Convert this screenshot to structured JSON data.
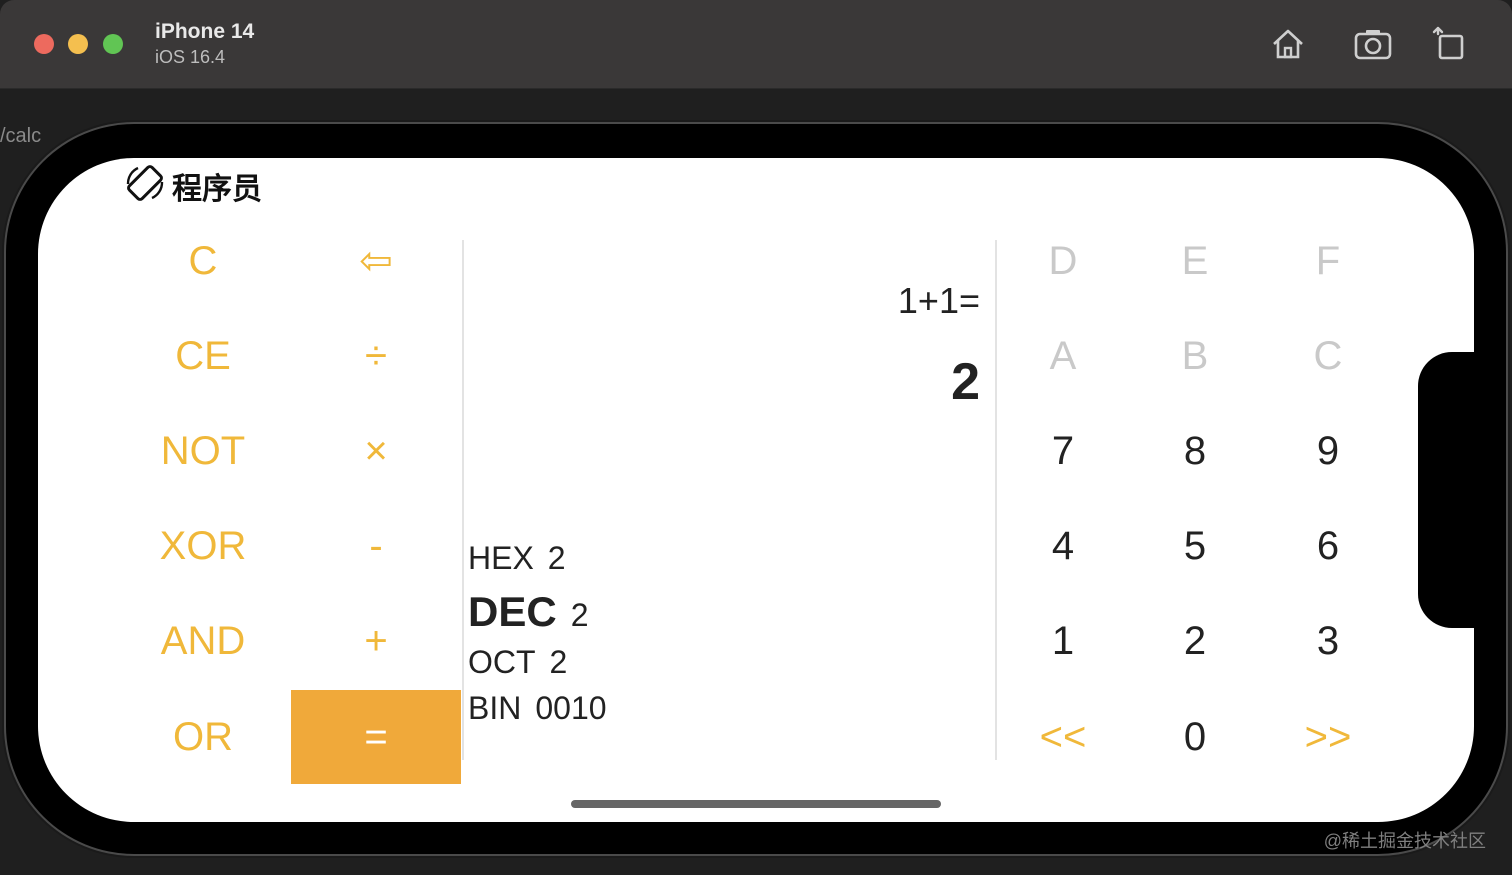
{
  "simulator": {
    "device": "iPhone 14",
    "os": "iOS 16.4",
    "icons": [
      "home-icon",
      "screenshot-icon",
      "rotate-icon"
    ]
  },
  "background": {
    "code_hint": "/calc",
    "watermark": "@稀土掘金技术社区"
  },
  "app": {
    "mode_label": "程序员",
    "mode_icon": "rotate-device-icon",
    "display": {
      "expression": "1+1=",
      "result": "2"
    },
    "bases": [
      {
        "name": "HEX",
        "value": "2",
        "selected": false
      },
      {
        "name": "DEC",
        "value": "2",
        "selected": true
      },
      {
        "name": "OCT",
        "value": "2",
        "selected": false
      },
      {
        "name": "BIN",
        "value": "0010",
        "selected": false
      }
    ],
    "left_keys": [
      {
        "label": "C"
      },
      {
        "label": "⇦"
      },
      {
        "label": "CE"
      },
      {
        "label": "÷"
      },
      {
        "label": "NOT"
      },
      {
        "label": "×"
      },
      {
        "label": "XOR"
      },
      {
        "label": "-"
      },
      {
        "label": "AND"
      },
      {
        "label": "+"
      },
      {
        "label": "OR"
      },
      {
        "label": "="
      }
    ],
    "right_keys": [
      {
        "label": "D",
        "enabled": false
      },
      {
        "label": "E",
        "enabled": false
      },
      {
        "label": "F",
        "enabled": false
      },
      {
        "label": "A",
        "enabled": false
      },
      {
        "label": "B",
        "enabled": false
      },
      {
        "label": "C",
        "enabled": false
      },
      {
        "label": "7",
        "enabled": true
      },
      {
        "label": "8",
        "enabled": true
      },
      {
        "label": "9",
        "enabled": true
      },
      {
        "label": "4",
        "enabled": true
      },
      {
        "label": "5",
        "enabled": true
      },
      {
        "label": "6",
        "enabled": true
      },
      {
        "label": "1",
        "enabled": true
      },
      {
        "label": "2",
        "enabled": true
      },
      {
        "label": "3",
        "enabled": true
      },
      {
        "label": "<<",
        "enabled": true
      },
      {
        "label": "0",
        "enabled": true
      },
      {
        "label": ">>",
        "enabled": true
      }
    ],
    "colors": {
      "accent": "#f0b83a",
      "equals_bg": "#f0a93a",
      "disabled": "#c9c9c9",
      "text": "#222222"
    }
  }
}
